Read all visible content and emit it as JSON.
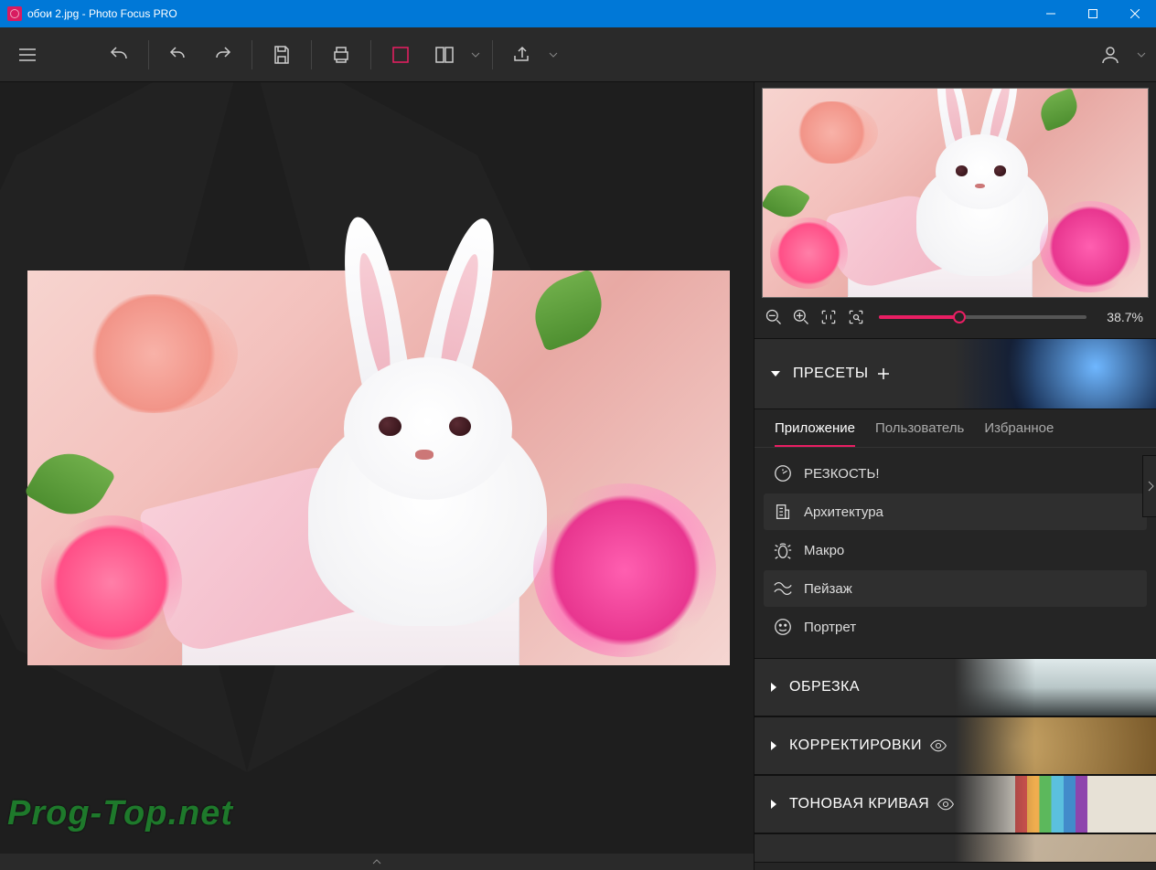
{
  "window": {
    "title": "обои 2.jpg - Photo Focus PRO"
  },
  "zoom": {
    "value": "38.7%"
  },
  "watermark": "Prog-Top.net",
  "panels": {
    "presets": {
      "label": "ПРЕСЕТЫ"
    },
    "crop": {
      "label": "ОБРЕЗКА"
    },
    "adjust": {
      "label": "КОРРЕКТИРОВКИ"
    },
    "curve": {
      "label": "ТОНОВАЯ КРИВАЯ"
    }
  },
  "tabs": {
    "app": "Приложение",
    "user": "Пользователь",
    "fav": "Избранное"
  },
  "presets": {
    "sharp": "РЕЗКОСТЬ!",
    "arch": "Архитектура",
    "macro": "Макро",
    "landscape": "Пейзаж",
    "portrait": "Портрет"
  }
}
